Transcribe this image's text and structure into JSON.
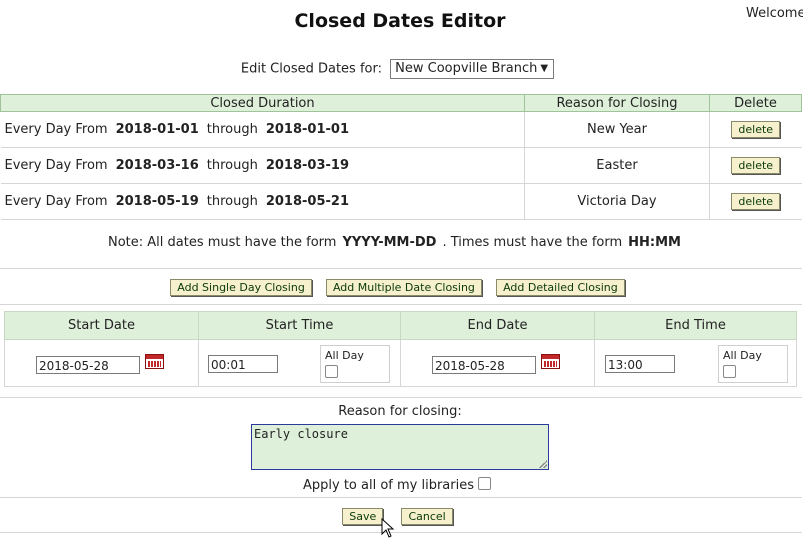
{
  "page": {
    "title": "Closed Dates Editor",
    "welcome": "Welcome"
  },
  "branch": {
    "label": "Edit Closed Dates for:",
    "selected": "New Coopville Branch"
  },
  "closed_table": {
    "headers": {
      "duration": "Closed Duration",
      "reason": "Reason for Closing",
      "delete": "Delete"
    },
    "rows": [
      {
        "prefix": "Every Day From",
        "start": "2018-01-01",
        "through": "through",
        "end": "2018-01-01",
        "reason": "New Year",
        "delete_label": "delete"
      },
      {
        "prefix": "Every Day From",
        "start": "2018-03-16",
        "through": "through",
        "end": "2018-03-19",
        "reason": "Easter",
        "delete_label": "delete"
      },
      {
        "prefix": "Every Day From",
        "start": "2018-05-19",
        "through": "through",
        "end": "2018-05-21",
        "reason": "Victoria Day",
        "delete_label": "delete"
      }
    ]
  },
  "note": {
    "part1": "Note: All dates must have the form",
    "date_form": "YYYY-MM-DD",
    "part2": ". Times must have the form",
    "time_form": "HH:MM"
  },
  "add_buttons": {
    "single": "Add Single Day Closing",
    "multiple": "Add Multiple Date Closing",
    "detailed": "Add Detailed Closing"
  },
  "editor": {
    "headers": {
      "start_date": "Start Date",
      "start_time": "Start Time",
      "end_date": "End Date",
      "end_time": "End Time"
    },
    "start_date": "2018-05-28",
    "start_time": "00:01",
    "end_date": "2018-05-28",
    "end_time": "13:00",
    "all_day_label": "All Day",
    "all_day_start_checked": false,
    "all_day_end_checked": false
  },
  "reason": {
    "label": "Reason for closing:",
    "value": "Early closure"
  },
  "apply": {
    "label": "Apply to all of my libraries",
    "checked": false
  },
  "actions": {
    "save": "Save",
    "cancel": "Cancel"
  },
  "colors": {
    "header_bg": "#dff0da",
    "button_bg": "#f6f0cc",
    "calendar_red": "#c0282a"
  }
}
